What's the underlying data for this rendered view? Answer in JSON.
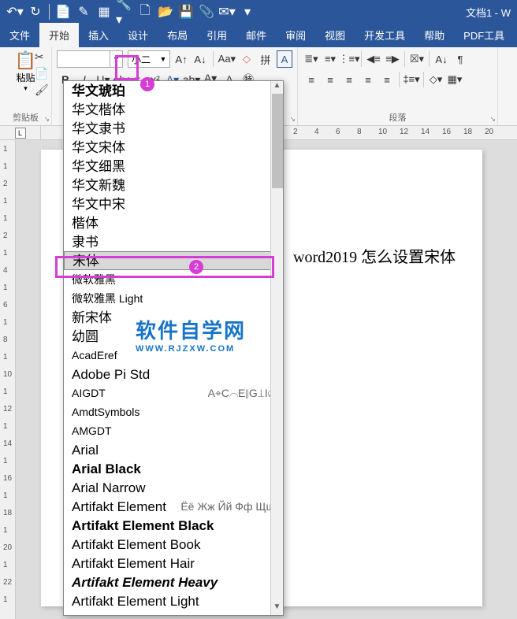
{
  "titlebar": {
    "docname": "文档1 - W"
  },
  "tabs": {
    "file": "文件",
    "home": "开始",
    "insert": "插入",
    "design": "设计",
    "layout": "布局",
    "ref": "引用",
    "mail": "邮件",
    "review": "审阅",
    "view": "视图",
    "dev": "开发工具",
    "help": "帮助",
    "pdf": "PDF工具"
  },
  "clipboard": {
    "paste": "粘贴",
    "group": "剪贴板"
  },
  "font": {
    "size": "小二",
    "input_value": ""
  },
  "para": {
    "group": "段落"
  },
  "ruler_h": [
    "2",
    "4",
    "6",
    "8",
    "10",
    "12",
    "14",
    "16",
    "18",
    "20"
  ],
  "ruler_v": [
    "1",
    "1",
    "2",
    "1",
    "1",
    "2",
    "1",
    "4",
    "1",
    "6",
    "1",
    "8",
    "1",
    "10",
    "1",
    "12",
    "1",
    "14",
    "1",
    "16",
    "1",
    "18",
    "1",
    "20",
    "1",
    "22",
    "1"
  ],
  "ruler_l": "L",
  "document": {
    "text": "word2019 怎么设置宋体"
  },
  "markers": {
    "m1": "1",
    "m2": "2"
  },
  "font_list": [
    {
      "label": "华文琥珀",
      "style": "font-family:STHupo;font-weight:bold;"
    },
    {
      "label": "华文楷体",
      "style": "font-family:STKaiti;"
    },
    {
      "label": "华文隶书",
      "style": "font-family:STLiti;"
    },
    {
      "label": "华文宋体",
      "style": "font-family:STSong;"
    },
    {
      "label": "华文细黑",
      "style": "font-family:STXihei;"
    },
    {
      "label": "华文新魏",
      "style": "font-family:STXinwei;"
    },
    {
      "label": "华文中宋",
      "style": "font-family:STZhongsong;"
    },
    {
      "label": "楷体",
      "style": "font-family:KaiTi;"
    },
    {
      "label": "隶书",
      "style": "font-family:LiSu;"
    },
    {
      "label": "宋体",
      "style": "font-family:SimSun;",
      "selected": true
    },
    {
      "label": "微软雅黑",
      "style": "font-family:Microsoft YaHei;font-size:14px;"
    },
    {
      "label": "微软雅黑 Light",
      "style": "font-family:Microsoft YaHei Light;font-size:14px;font-weight:300;"
    },
    {
      "label": "新宋体",
      "style": "font-family:NSimSun;"
    },
    {
      "label": "幼圆",
      "style": "font-family:YouYuan;"
    },
    {
      "label": "AcadEref",
      "style": "font-family:sans-serif;font-size:14px;"
    },
    {
      "label": "Adobe Pi Std",
      "style": "font-family:serif;"
    },
    {
      "label": "AIGDT",
      "style": "font-family:sans-serif;font-size:14px;",
      "sample": "A⌖C⌒E∥G⟂I⌀"
    },
    {
      "label": "AmdtSymbols",
      "style": "font-family:sans-serif;font-size:14px;"
    },
    {
      "label": "AMGDT",
      "style": "font-family:sans-serif;font-size:14px;"
    },
    {
      "label": "Arial",
      "style": "font-family:Arial;"
    },
    {
      "label": "Arial Black",
      "style": "font-family:Arial Black;font-weight:900;"
    },
    {
      "label": "Arial Narrow",
      "style": "font-family:Arial Narrow;"
    },
    {
      "label": "Artifakt Element",
      "style": "font-family:sans-serif;",
      "sample": "Ёё Жж Йй Фф Щщ"
    },
    {
      "label": "Artifakt Element Black",
      "style": "font-family:sans-serif;font-weight:900;"
    },
    {
      "label": "Artifakt Element Book",
      "style": "font-family:sans-serif;"
    },
    {
      "label": "Artifakt Element Hair",
      "style": "font-family:sans-serif;font-weight:200;"
    },
    {
      "label": "Artifakt Element Heavy",
      "style": "font-family:sans-serif;font-weight:900;font-style:italic;"
    },
    {
      "label": "Artifakt Element Light",
      "style": "font-family:sans-serif;font-weight:300;"
    }
  ],
  "watermark": {
    "line1": "软件自学网",
    "line2": "WWW.RJZXW.COM"
  }
}
